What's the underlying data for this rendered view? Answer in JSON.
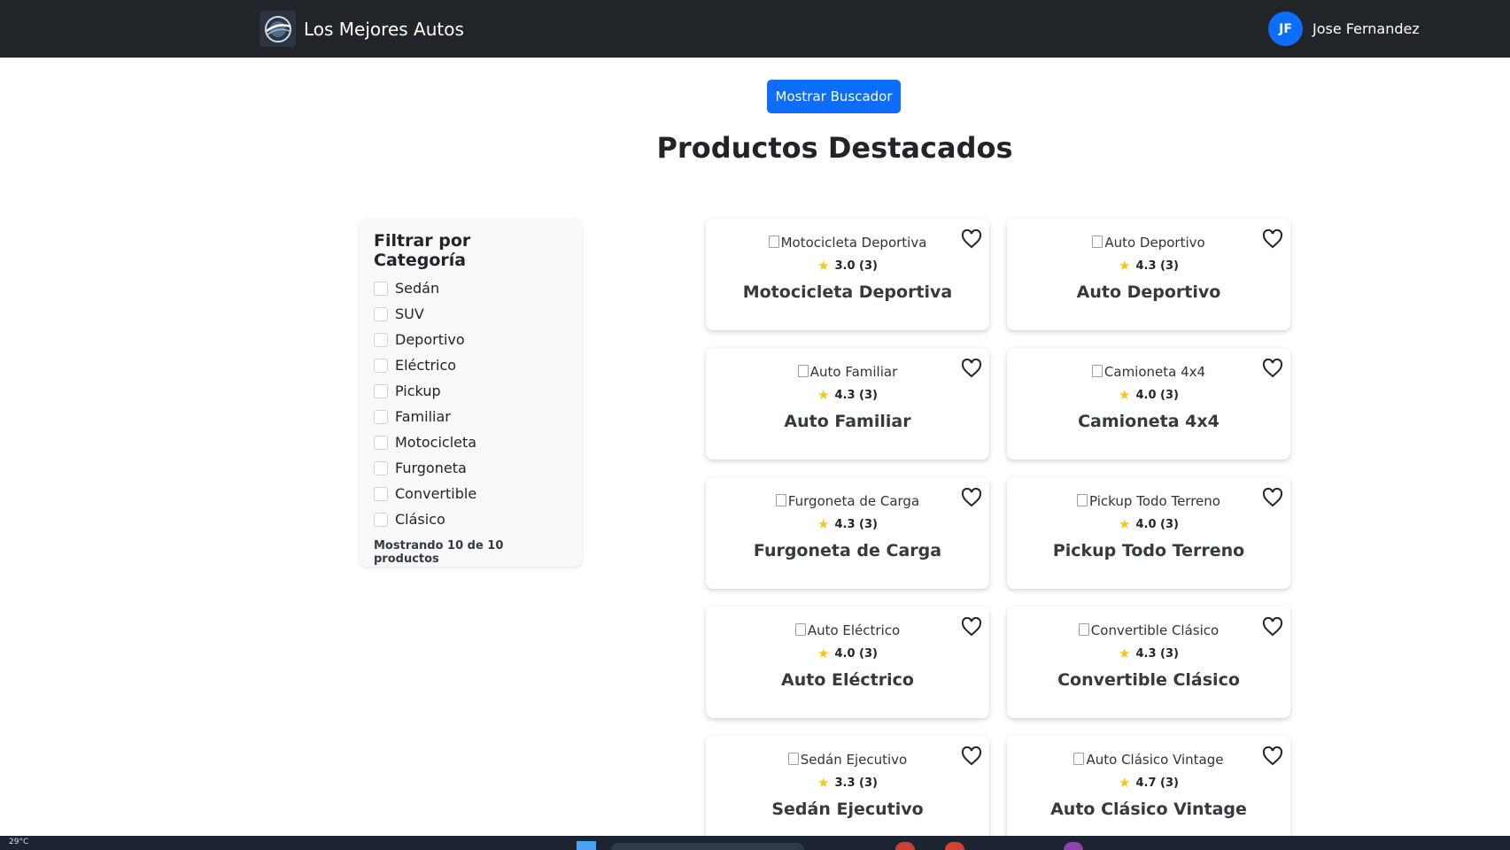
{
  "navbar": {
    "brand_name": "Los Mejores Autos",
    "logo_icon": "car-wheel-logo-icon",
    "user_initials": "JF",
    "user_name": "Jose Fernandez"
  },
  "search": {
    "toggle_label": "Mostrar Buscador"
  },
  "page_title": "Productos Destacados",
  "filters": {
    "title": "Filtrar por Categoría",
    "categories": [
      {
        "label": "Sedán",
        "checked": false
      },
      {
        "label": "SUV",
        "checked": false
      },
      {
        "label": "Deportivo",
        "checked": false
      },
      {
        "label": "Eléctrico",
        "checked": false
      },
      {
        "label": "Pickup",
        "checked": false
      },
      {
        "label": "Familiar",
        "checked": false
      },
      {
        "label": "Motocicleta",
        "checked": false
      },
      {
        "label": "Furgoneta",
        "checked": false
      },
      {
        "label": "Convertible",
        "checked": false
      },
      {
        "label": "Clásico",
        "checked": false
      }
    ],
    "count_text": "Mostrando 10 de 10 productos"
  },
  "products": [
    {
      "image_alt": "Motocicleta Deportiva",
      "rating": "3.0 (3)",
      "name": "Motocicleta Deportiva"
    },
    {
      "image_alt": "Auto Deportivo",
      "rating": "4.3 (3)",
      "name": "Auto Deportivo"
    },
    {
      "image_alt": "Auto Familiar",
      "rating": "4.3 (3)",
      "name": "Auto Familiar"
    },
    {
      "image_alt": "Camioneta 4x4",
      "rating": "4.0 (3)",
      "name": "Camioneta 4x4"
    },
    {
      "image_alt": "Furgoneta de Carga",
      "rating": "4.3 (3)",
      "name": "Furgoneta de Carga"
    },
    {
      "image_alt": "Pickup Todo Terreno",
      "rating": "4.0 (3)",
      "name": "Pickup Todo Terreno"
    },
    {
      "image_alt": "Auto Eléctrico",
      "rating": "4.0 (3)",
      "name": "Auto Eléctrico"
    },
    {
      "image_alt": "Convertible Clásico",
      "rating": "4.3 (3)",
      "name": "Convertible Clásico"
    },
    {
      "image_alt": "Sedán Ejecutivo",
      "rating": "3.3 (3)",
      "name": "Sedán Ejecutivo"
    },
    {
      "image_alt": "Auto Clásico Vintage",
      "rating": "4.7 (3)",
      "name": "Auto Clásico Vintage"
    }
  ],
  "icons": {
    "star": "star-icon",
    "favorite": "heart-outline-icon"
  },
  "colors": {
    "navbar": "#212529",
    "primary": "#0d6efd",
    "star": "#f5c518"
  },
  "taskbar": {
    "weather": "29°C"
  }
}
